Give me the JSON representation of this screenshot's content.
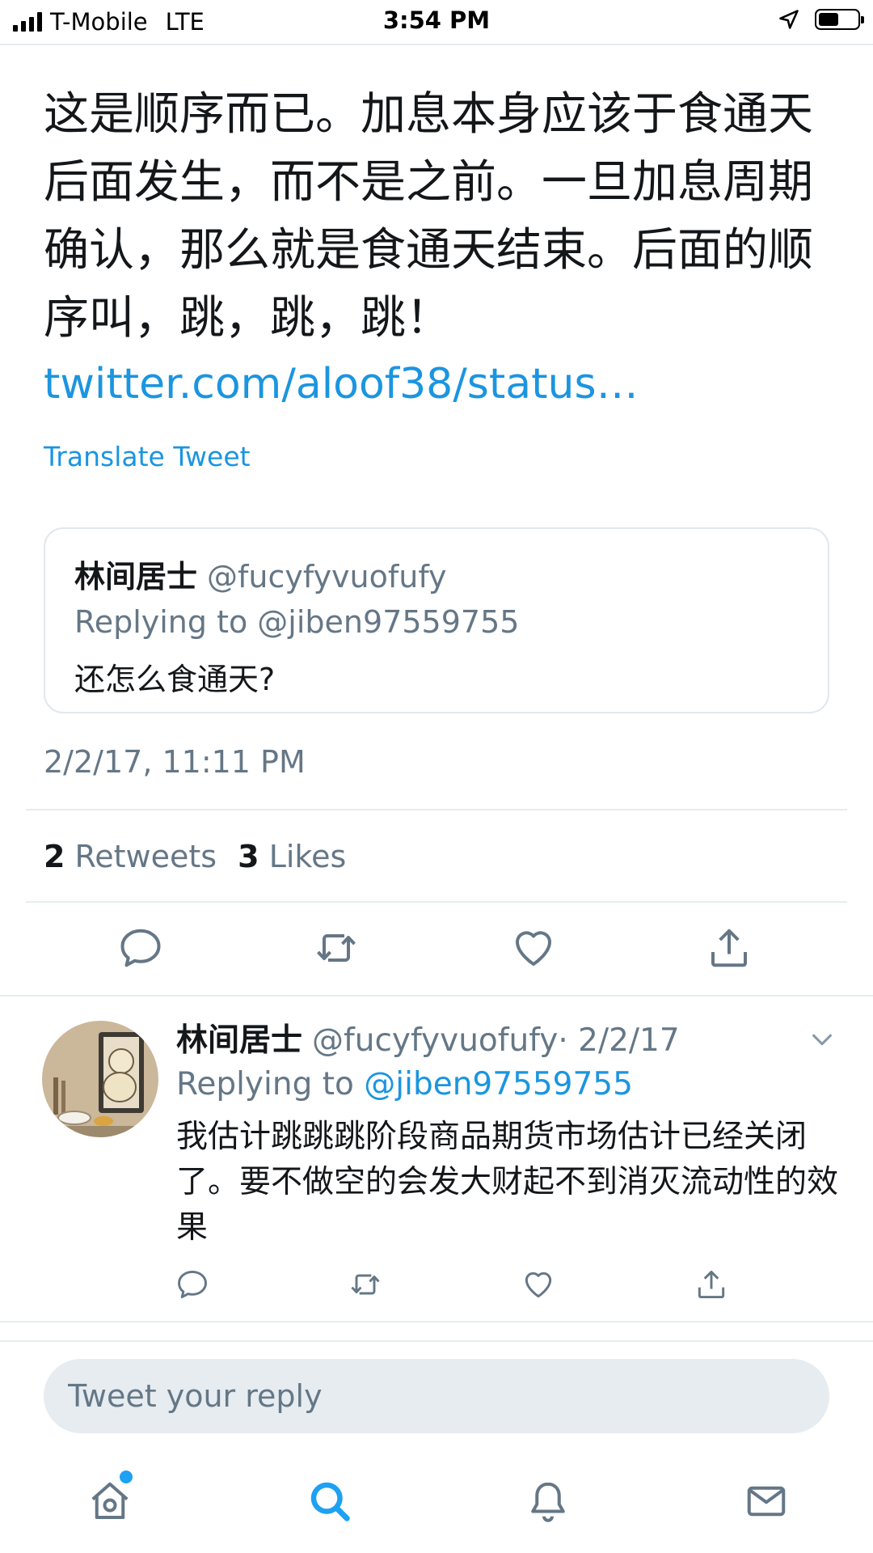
{
  "status_bar": {
    "carrier": "T-Mobile",
    "network": "LTE",
    "time": "3:54 PM"
  },
  "tweet": {
    "text": "这是顺序而已。加息本身应该于食通天后面发生，而不是之前。一旦加息周期确认，那么就是食通天结束。后面的顺序叫，跳，跳，跳！",
    "link": "twitter.com/aloof38/status…",
    "translate_label": "Translate Tweet",
    "timestamp": "2/2/17, 11:11 PM",
    "retweets": "2",
    "retweets_label": "Retweets",
    "likes": "3",
    "likes_label": "Likes"
  },
  "quoted_tweet": {
    "name": "林间居士",
    "handle": "@fucyfyvuofufy",
    "replying_to": "Replying to @jiben97559755",
    "text": "还怎么食通天?"
  },
  "reply": {
    "name": "林间居士",
    "handle": "@fucyfyvuofufy",
    "date": "· 2/2/17",
    "replying_prefix": "Replying to",
    "mention": "@jiben97559755",
    "text": "我估计跳跳跳阶段商品期货市场估计已经关闭了。要不做空的会发大财起不到消灭流动性的效果"
  },
  "composer": {
    "placeholder": "Tweet your reply"
  },
  "colors": {
    "accent": "#1da1f2",
    "link": "#1b95e0",
    "secondary_text": "#657786",
    "divider": "#e6ecf0"
  },
  "icons": [
    "reply-icon",
    "retweet-icon",
    "like-icon",
    "share-icon",
    "chevron-down-icon",
    "home-icon",
    "search-icon",
    "notifications-icon",
    "messages-icon",
    "location-arrow-icon",
    "battery-icon",
    "signal-icon"
  ]
}
